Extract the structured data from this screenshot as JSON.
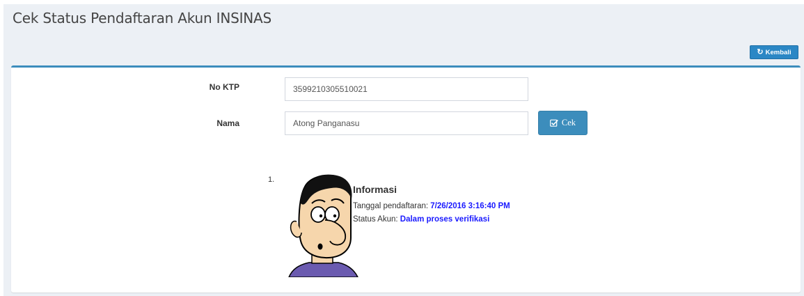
{
  "page": {
    "title": "Cek Status Pendaftaran Akun INSINAS",
    "back_button": {
      "label": "Kembali",
      "icon": "undo-icon"
    }
  },
  "form": {
    "no_ktp": {
      "label": "No KTP",
      "value": "3599210305510021"
    },
    "nama": {
      "label": "Nama",
      "value": "Atong Panganasu"
    },
    "cek_button": {
      "label": "Cek",
      "icon": "check-square-icon"
    }
  },
  "result": {
    "number": "1.",
    "avatar": "cartoon-face-avatar",
    "title": "Informasi",
    "tanggal_label": "Tanggal pendaftaran:",
    "tanggal_value": "7/26/2016 3:16:40 PM",
    "status_label": "Status Akun:",
    "status_value": "Dalam proses verifikasi"
  },
  "colors": {
    "accent": "#3c8dbc",
    "value_text": "#1a1aff",
    "page_background": "#ecf0f5"
  }
}
